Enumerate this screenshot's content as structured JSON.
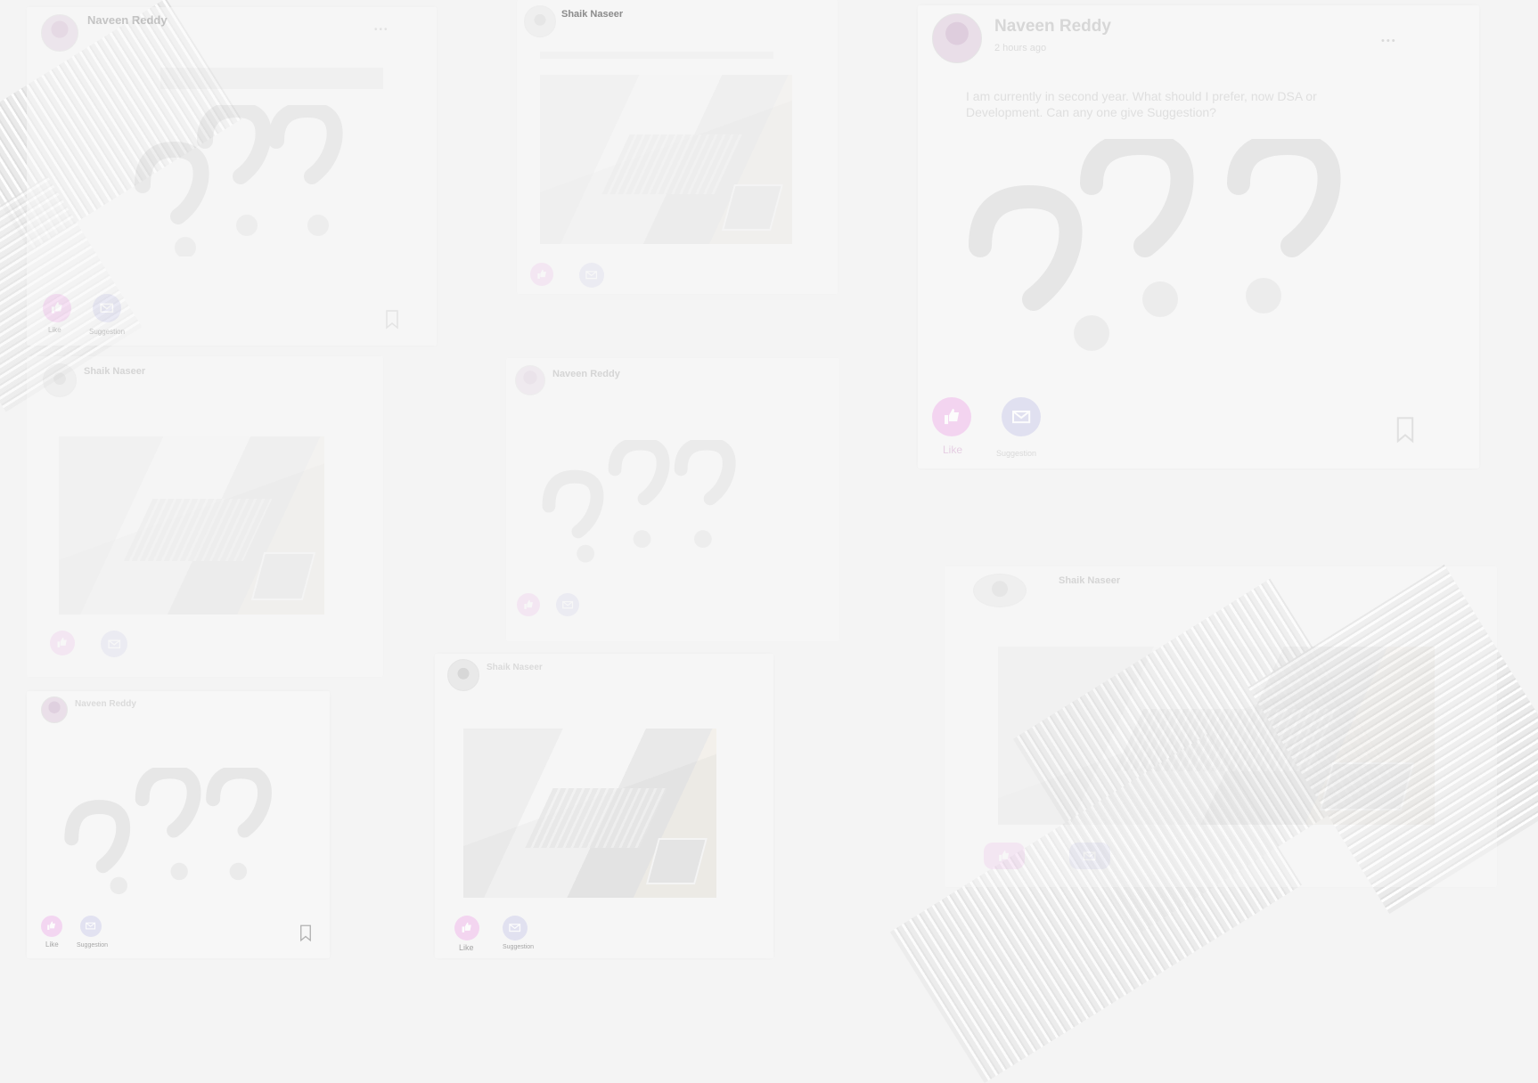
{
  "posts": {
    "p1": {
      "name": "Naveen Reddy",
      "like": "Like",
      "suggestion": "Suggestion"
    },
    "p2": {
      "name": "Shaik Naseer"
    },
    "p3": {
      "name": "Naveen Reddy",
      "time": "2 hours ago",
      "text": "I am currently in second year. What should I prefer, now DSA or Development. Can any one give Suggestion?",
      "like": "Like",
      "suggestion": "Suggestion"
    },
    "p4": {
      "name": "Shaik Naseer"
    },
    "p5": {
      "name": "Naveen Reddy"
    },
    "p6": {
      "name": "Shaik Naseer"
    },
    "p7": {
      "name": "Naveen Reddy",
      "like": "Like",
      "suggestion": "Suggestion"
    },
    "p8": {
      "name": "Shaik Naseer",
      "like": "Like",
      "suggestion": "Suggestion"
    }
  },
  "colors": {
    "background": "#f4f4f4",
    "like_button": "#f3cdf0",
    "suggestion_button": "#dcdcf0",
    "name_text": "#9d9d9d"
  },
  "icons": [
    "thumbs-up-icon",
    "envelope-icon",
    "bookmark-icon",
    "question-mark-icon",
    "more-dots-icon"
  ]
}
